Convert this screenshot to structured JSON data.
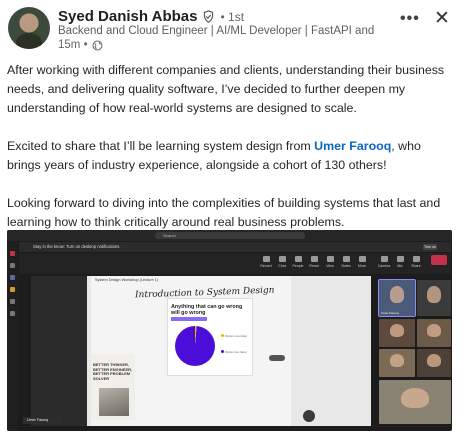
{
  "author": {
    "name": "Syed Danish Abbas",
    "degree": "• 1st",
    "headline": "Backend and Cloud Engineer | AI/ML Developer | FastAPI and ...",
    "time": "15m •"
  },
  "actions": {
    "more": "•••",
    "close": "✕"
  },
  "post": {
    "p1": "After working with different companies and clients, understanding their business needs, and delivering quality software, I’ve decided to further deepen my understanding of how real-world systems are designed to scale.",
    "p2_before": "Excited to share that I’ll be learning system design from ",
    "p2_mention": "Umer Farooq",
    "p2_after": ", who brings years of industry experience, alongside a cohort of 130 others!",
    "p3": "Looking forward to diving into the complexities of building systems that last and learning how to think critically around real business problems."
  },
  "screenshot": {
    "search": "Search",
    "notification": "Stay in the know: Turn on desktop notifications.",
    "notification_button": "Turn on",
    "controls": [
      "Record",
      "Chat",
      "People",
      "React",
      "View",
      "Notes",
      "More",
      "Camera",
      "Mic",
      "Share",
      "Leave"
    ],
    "board_header": "System Design Workshop (Lecture 1)",
    "handwritten_title": "Introduction to System Design",
    "card_title": "Anything that can go wrong will go wrong",
    "legend": [
      "Option one label",
      "Option two label"
    ],
    "side_text": "BETTER THINKER, BETTER ENGINEER, BETTER PROBLEM SOLVER",
    "presenter_chip": "Umer Farooq",
    "tile_labels": [
      "Umer Farooq",
      "",
      "",
      "",
      "",
      "",
      ""
    ]
  }
}
